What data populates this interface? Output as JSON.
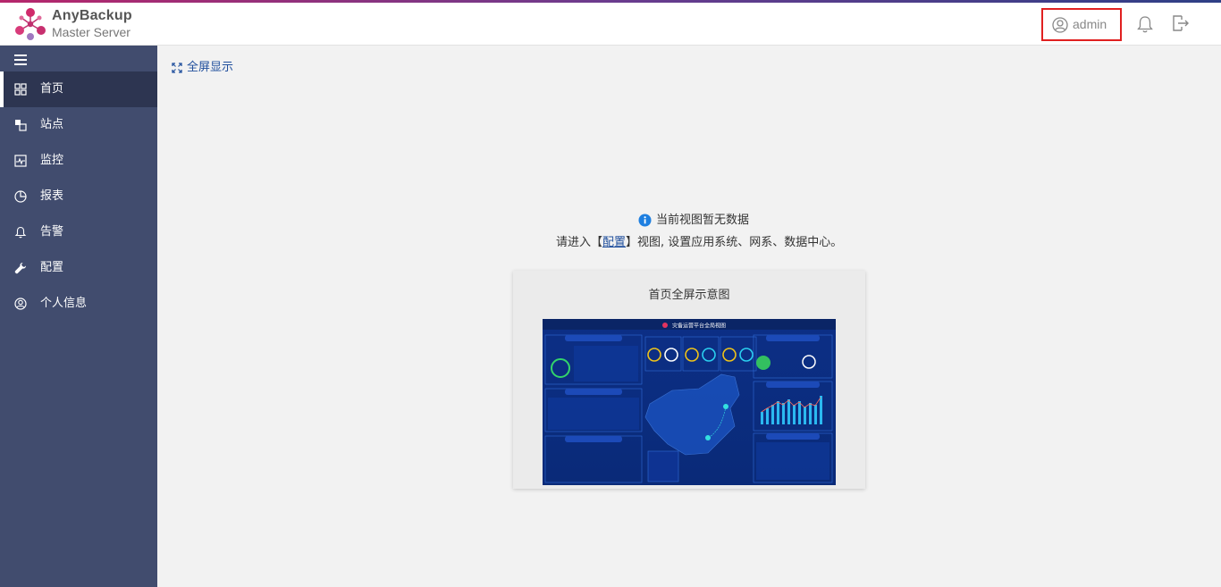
{
  "app": {
    "brand_name": "AnyBackup",
    "brand_sub": "Master Server",
    "colors": {
      "sidebar": "#414c6e",
      "sidebar_active": "#2d3551",
      "link": "#1f4e9c",
      "highlight": "#e02020"
    }
  },
  "header": {
    "user": {
      "icon": "user-circle-icon",
      "name": "admin"
    },
    "notification_icon": "bell-icon",
    "logout_icon": "logout-icon"
  },
  "sidebar": {
    "toggle_icon": "hamburger-icon",
    "items": [
      {
        "label": "首页",
        "icon": "grid-icon",
        "active": true
      },
      {
        "label": "站点",
        "icon": "site-icon",
        "active": false
      },
      {
        "label": "监控",
        "icon": "monitor-icon",
        "active": false
      },
      {
        "label": "报表",
        "icon": "pie-chart-icon",
        "active": false
      },
      {
        "label": "告警",
        "icon": "bell-icon",
        "active": false
      },
      {
        "label": "配置",
        "icon": "wrench-icon",
        "active": false
      },
      {
        "label": "个人信息",
        "icon": "user-circle-icon",
        "active": false
      }
    ]
  },
  "main": {
    "fullscreen_label": "全屏显示",
    "empty_title": "当前视图暂无数据",
    "hint_prefix": "请进入【",
    "hint_link": "配置",
    "hint_suffix": "】视图, 设置应用系统、网系、数据中心。",
    "preview_card": {
      "title": "首页全屏示意图",
      "image_title": "灾备运营平台全局视图"
    }
  }
}
